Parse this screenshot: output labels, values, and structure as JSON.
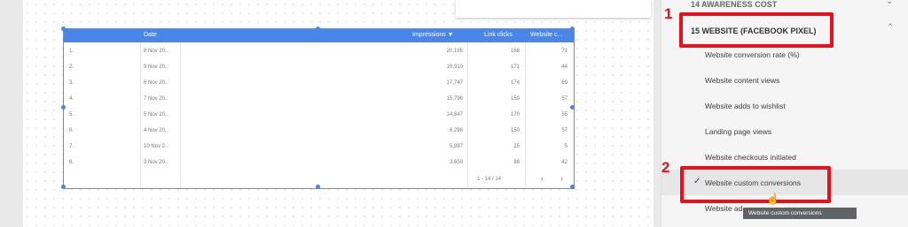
{
  "table": {
    "headers": [
      "Date",
      "Impressions ▼",
      "Link clicks",
      "Website c..."
    ],
    "rows": [
      {
        "idx": "1.",
        "date": "8 Nov 20..",
        "impressions": "20,195",
        "clicks": "168",
        "website": "71"
      },
      {
        "idx": "2.",
        "date": "9 Nov 20..",
        "impressions": "19,910",
        "clicks": "171",
        "website": "44"
      },
      {
        "idx": "3.",
        "date": "6 Nov 20..",
        "impressions": "17,747",
        "clicks": "174",
        "website": "69"
      },
      {
        "idx": "4.",
        "date": "7 Nov 20..",
        "impressions": "15,796",
        "clicks": "159",
        "website": "57"
      },
      {
        "idx": "5.",
        "date": "5 Nov 20..",
        "impressions": "14,847",
        "clicks": "170",
        "website": "55"
      },
      {
        "idx": "6.",
        "date": "4 Nov 20..",
        "impressions": "6,298",
        "clicks": "150",
        "website": "57"
      },
      {
        "idx": "7.",
        "date": "10 Nov 2..",
        "impressions": "5,887",
        "clicks": "25",
        "website": "5"
      },
      {
        "idx": "8.",
        "date": "3 Nov 20..",
        "impressions": "3,659",
        "clicks": "86",
        "website": "42"
      }
    ],
    "pagination": "1 - 14 / 14",
    "prev_icon": "‹",
    "next_icon": "›"
  },
  "panel": {
    "top_group": "14 AWARENESS COST",
    "group": "15 WEBSITE (FACEBOOK PIXEL)",
    "items": [
      "Website conversion rate (%)",
      "Website content views",
      "Website adds to wishlist",
      "Landing page views",
      "Website checkouts initiated",
      "Website custom conversions",
      "Website ad"
    ],
    "selected_check": "✓",
    "tooltip": "Website custom conversions"
  },
  "annotations": {
    "one": "1",
    "two": "2",
    "color": "#e8101b"
  }
}
